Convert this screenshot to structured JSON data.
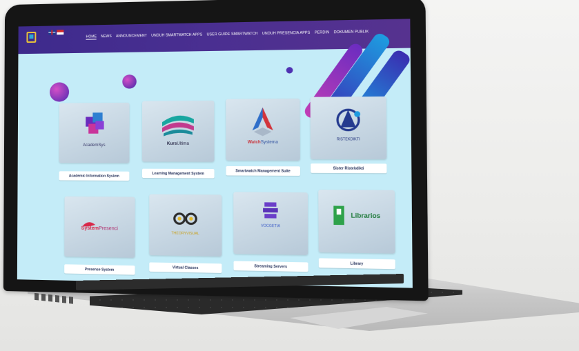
{
  "header": {
    "logo_caption": "",
    "flags": [
      "uk-flag-icon",
      "indonesia-flag-icon"
    ],
    "nav": [
      {
        "label": "HOME",
        "active": true
      },
      {
        "label": "NEWS",
        "active": false
      },
      {
        "label": "ANNOUNCEMENT",
        "active": false
      },
      {
        "label": "UNDUH SMARTWATCH APPS",
        "active": false
      },
      {
        "label": "USER GUIDE SMARTWATCH",
        "active": false
      },
      {
        "label": "UNDUH PRESENCIA APPS",
        "active": false
      },
      {
        "label": "PERDIN",
        "active": false
      },
      {
        "label": "DOKUMEN PUBLIK",
        "active": false
      }
    ]
  },
  "apps": [
    {
      "brand": "AcademSys",
      "label": "Academic Information System",
      "icon": "academsys-logo-icon"
    },
    {
      "brand_bold": "Kurs",
      "brand_rest": "Ultima",
      "label": "Learning Management System",
      "icon": "kursultima-logo-icon"
    },
    {
      "brand_bold": "Watch",
      "brand_rest": "Systema",
      "label": "Smartwatch Management Suite",
      "icon": "watchsystema-logo-icon"
    },
    {
      "brand": "RISTEKDIKTI",
      "label": "Sister Ristekdikti",
      "icon": "ristekdikti-logo-icon"
    },
    {
      "brand_bold": "System",
      "brand_rest": "Presenci",
      "label": "Presense System",
      "icon": "systempresenci-logo-icon"
    },
    {
      "brand": "THEORYVISUAL",
      "label": "Virtual Classes",
      "icon": "virtual-classes-logo-icon"
    },
    {
      "brand": "VOCGETIA",
      "label": "Streaming Servers",
      "icon": "vocgetia-logo-icon"
    },
    {
      "brand": "Librarios",
      "label": "Library",
      "icon": "librarios-logo-icon"
    }
  ],
  "colors": {
    "topbar": "#4a2f91",
    "screen_bg": "#c4ecf8",
    "label_text": "#23305a"
  }
}
